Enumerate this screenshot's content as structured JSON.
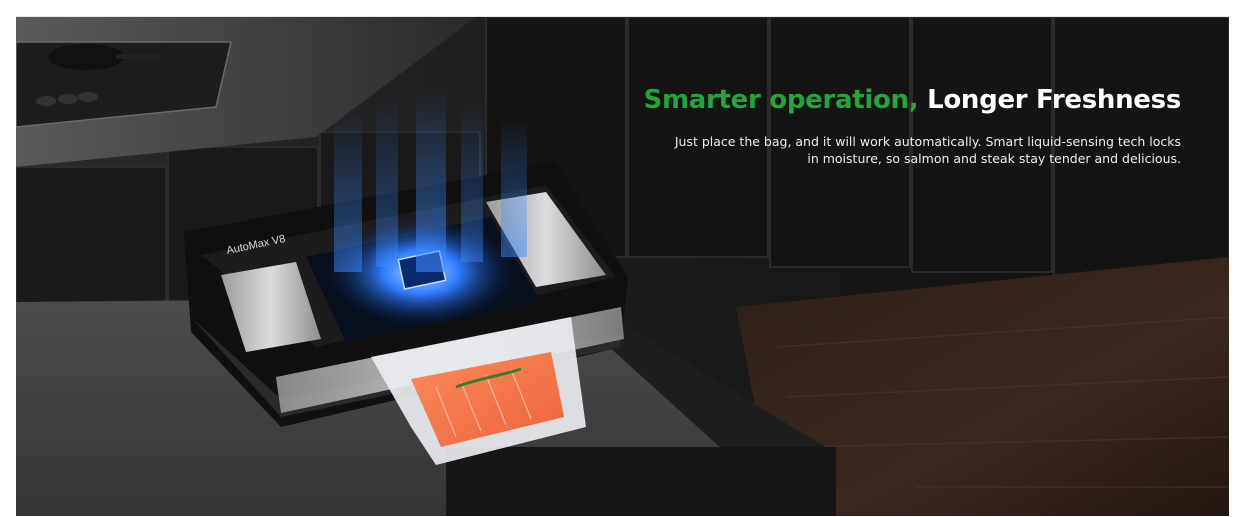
{
  "banner": {
    "headline_accent": "Smarter operation,",
    "headline_main": " Longer Freshness",
    "description": "Just place the bag, and it will work automatically. Smart liquid-sensing tech locks in moisture, so salmon and steak stay tender and delicious.",
    "device_label": "AutoMax V8"
  },
  "colors": {
    "accent": "#22a63b",
    "headline_text": "#ffffff",
    "glow": "#3d8bff"
  },
  "icons": [
    "cooktop-pan-icon",
    "chip-icon",
    "herb-sprig-icon"
  ]
}
